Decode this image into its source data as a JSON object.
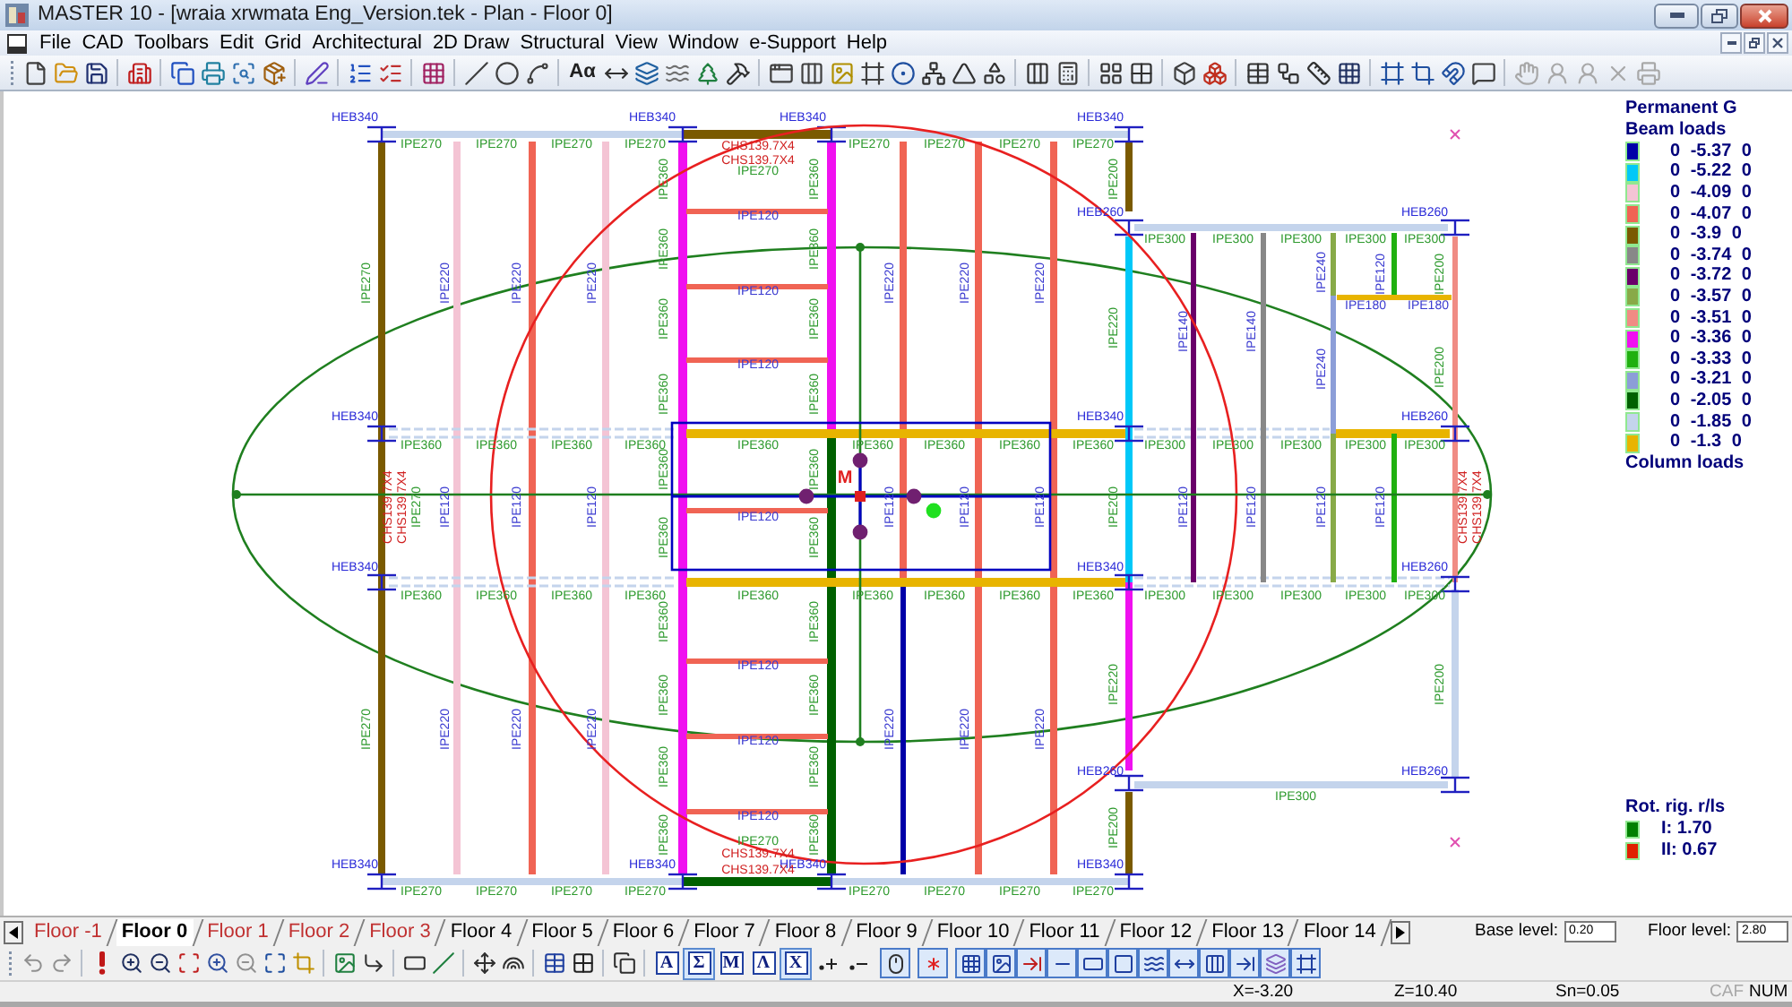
{
  "window": {
    "title": "MASTER 10 - [wraia xrwmata Eng_Version.tek - Plan - Floor 0]"
  },
  "menu": [
    "File",
    "CAD",
    "Toolbars",
    "Edit",
    "Grid",
    "Architectural",
    "2D Draw",
    "Structural",
    "View",
    "Window",
    "e-Support",
    "Help"
  ],
  "toolbar": {
    "text_button": "Aα"
  },
  "plan": {
    "column_labels": [
      "HEB340",
      "HEB340",
      "HEB340",
      "HEB340",
      "HEB260",
      "HEB260",
      "HEB340",
      "HEB340",
      "HEB260",
      "HEB340",
      "HEB340",
      "HEB260",
      "HEB260",
      "HEB260",
      "HEB340",
      "HEB340",
      "HEB340",
      "HEB340"
    ],
    "beam_labels": [
      "IPE270",
      "IPE270",
      "IPE270",
      "IPE270",
      "IPE270",
      "IPE270",
      "IPE270",
      "IPE270",
      "IPE270",
      "IPE120",
      "IPE120",
      "IPE120",
      "IPE300",
      "IPE300",
      "IPE300",
      "IPE300",
      "IPE300",
      "IPE180",
      "IPE180",
      "IPE360",
      "IPE360",
      "IPE360",
      "IPE360",
      "IPE360",
      "IPE360",
      "IPE360",
      "IPE360",
      "IPE360",
      "IPE300",
      "IPE300",
      "IPE300",
      "IPE300",
      "IPE300",
      "IPE120",
      "IPE360",
      "IPE360",
      "IPE360",
      "IPE360",
      "IPE360",
      "IPE360",
      "IPE360",
      "IPE360",
      "IPE360",
      "IPE300",
      "IPE300",
      "IPE300",
      "IPE300",
      "IPE300",
      "IPE120",
      "IPE120",
      "IPE120",
      "IPE270",
      "IPE300",
      "IPE270",
      "IPE270",
      "IPE270",
      "IPE270",
      "IPE270",
      "IPE270",
      "IPE270",
      "IPE270"
    ],
    "member_labels": [
      "IPE270",
      "IPE220",
      "IPE220",
      "IPE220",
      "IPE360",
      "IPE360",
      "IPE360",
      "IPE360",
      "IPE360",
      "IPE360",
      "IPE360",
      "IPE360",
      "IPE220",
      "IPE220",
      "IPE220",
      "IPE200",
      "IPE220",
      "IPE240",
      "IPE120",
      "IPE200",
      "IPE140",
      "IPE140",
      "IPE240",
      "IPE200",
      "IPE270",
      "IPE120",
      "IPE120",
      "IPE120",
      "IPE360",
      "IPE360",
      "IPE360",
      "IPE360",
      "IPE120",
      "IPE120",
      "IPE120",
      "IPE200",
      "IPE120",
      "IPE120",
      "IPE120",
      "IPE120",
      "IPE270",
      "IPE220",
      "IPE220",
      "IPE220",
      "IPE360",
      "IPE360",
      "IPE360",
      "IPE360",
      "IPE360",
      "IPE360",
      "IPE360",
      "IPE360",
      "IPE220",
      "IPE220",
      "IPE220",
      "IPE220",
      "IPE200",
      "IPE200"
    ],
    "section_labels": [
      "CHS139.7X4",
      "CHS139.7X4",
      "CHS139.7X4",
      "CHS139.7X4",
      "CHS139.7X4",
      "CHS139.7X4",
      "CHS139.7X4",
      "CHS139.7X4"
    ],
    "marker_label": "M"
  },
  "legend": {
    "title": "Permanent G",
    "beam_heading": "Beam loads",
    "beam_loads": [
      {
        "color": "#0000a8",
        "text": "0 -5.37 0"
      },
      {
        "color": "#00c8f8",
        "text": "0 -5.22 0"
      },
      {
        "color": "#f4c4d4",
        "text": "0 -4.09 0"
      },
      {
        "color": "#f06454",
        "text": "0 -4.07 0"
      },
      {
        "color": "#7a5a00",
        "text": "0 -3.9 0"
      },
      {
        "color": "#888888",
        "text": "0 -3.74 0"
      },
      {
        "color": "#6a006a",
        "text": "0 -3.72 0"
      },
      {
        "color": "#88aa48",
        "text": "0 -3.57 0"
      },
      {
        "color": "#f08c84",
        "text": "0 -3.51 0"
      },
      {
        "color": "#f010f0",
        "text": "0 -3.36 0"
      },
      {
        "color": "#20b010",
        "text": "0 -3.33 0"
      },
      {
        "color": "#8c9ed8",
        "text": "0 -3.21 0"
      },
      {
        "color": "#006000",
        "text": "0 -2.05 0"
      },
      {
        "color": "#c4d4ec",
        "text": "0 -1.85 0"
      },
      {
        "color": "#e8b400",
        "text": "0 -1.3 0"
      }
    ],
    "column_heading": "Column loads",
    "rotation_heading": "Rot. rig. r/ls",
    "rotation": [
      {
        "color": "#008000",
        "text": "I: 1.70"
      },
      {
        "color": "#e02000",
        "text": "II: 0.67"
      }
    ]
  },
  "floor_tabs": [
    {
      "label": "Floor -1",
      "selected": false,
      "color": "#c03030"
    },
    {
      "label": "Floor 0",
      "selected": true,
      "color": "#000000"
    },
    {
      "label": "Floor 1",
      "selected": false,
      "color": "#c03030"
    },
    {
      "label": "Floor 2",
      "selected": false,
      "color": "#c03030"
    },
    {
      "label": "Floor 3",
      "selected": false,
      "color": "#c03030"
    },
    {
      "label": "Floor 4",
      "selected": false,
      "color": "#000000"
    },
    {
      "label": "Floor 5",
      "selected": false,
      "color": "#000000"
    },
    {
      "label": "Floor 6",
      "selected": false,
      "color": "#000000"
    },
    {
      "label": "Floor 7",
      "selected": false,
      "color": "#000000"
    },
    {
      "label": "Floor 8",
      "selected": false,
      "color": "#000000"
    },
    {
      "label": "Floor 9",
      "selected": false,
      "color": "#000000"
    },
    {
      "label": "Floor 10",
      "selected": false,
      "color": "#000000"
    },
    {
      "label": "Floor 11",
      "selected": false,
      "color": "#000000"
    },
    {
      "label": "Floor 12",
      "selected": false,
      "color": "#000000"
    },
    {
      "label": "Floor 13",
      "selected": false,
      "color": "#000000"
    },
    {
      "label": "Floor 14",
      "selected": false,
      "color": "#000000"
    }
  ],
  "base_level": {
    "label": "Base level:",
    "value": "0.20"
  },
  "floor_level": {
    "label": "Floor level:",
    "value": "2.80"
  },
  "bottom_toolbar": {
    "letter_buttons": [
      {
        "label": "A",
        "selected": false
      },
      {
        "label": "Σ",
        "selected": true
      },
      {
        "label": "M",
        "selected": false
      },
      {
        "label": "Λ",
        "selected": false
      },
      {
        "label": "X",
        "selected": true
      }
    ],
    "snap_buttons": [
      {
        "selected": true
      },
      {
        "selected": true
      },
      {
        "selected": true
      },
      {
        "selected": true
      },
      {
        "selected": true
      },
      {
        "selected": true
      },
      {
        "selected": true
      },
      {
        "selected": true
      },
      {
        "selected": true
      },
      {
        "selected": true
      },
      {
        "selected": true
      },
      {
        "selected": true
      },
      {
        "selected": true
      },
      {
        "selected": true
      }
    ]
  },
  "status_bar": {
    "x": "X=-3.20",
    "z": "Z=10.40",
    "snap": "Sn=0.05",
    "caps": {
      "label": "CAF",
      "on": false
    },
    "num": {
      "label": "NUM",
      "on": true
    }
  }
}
